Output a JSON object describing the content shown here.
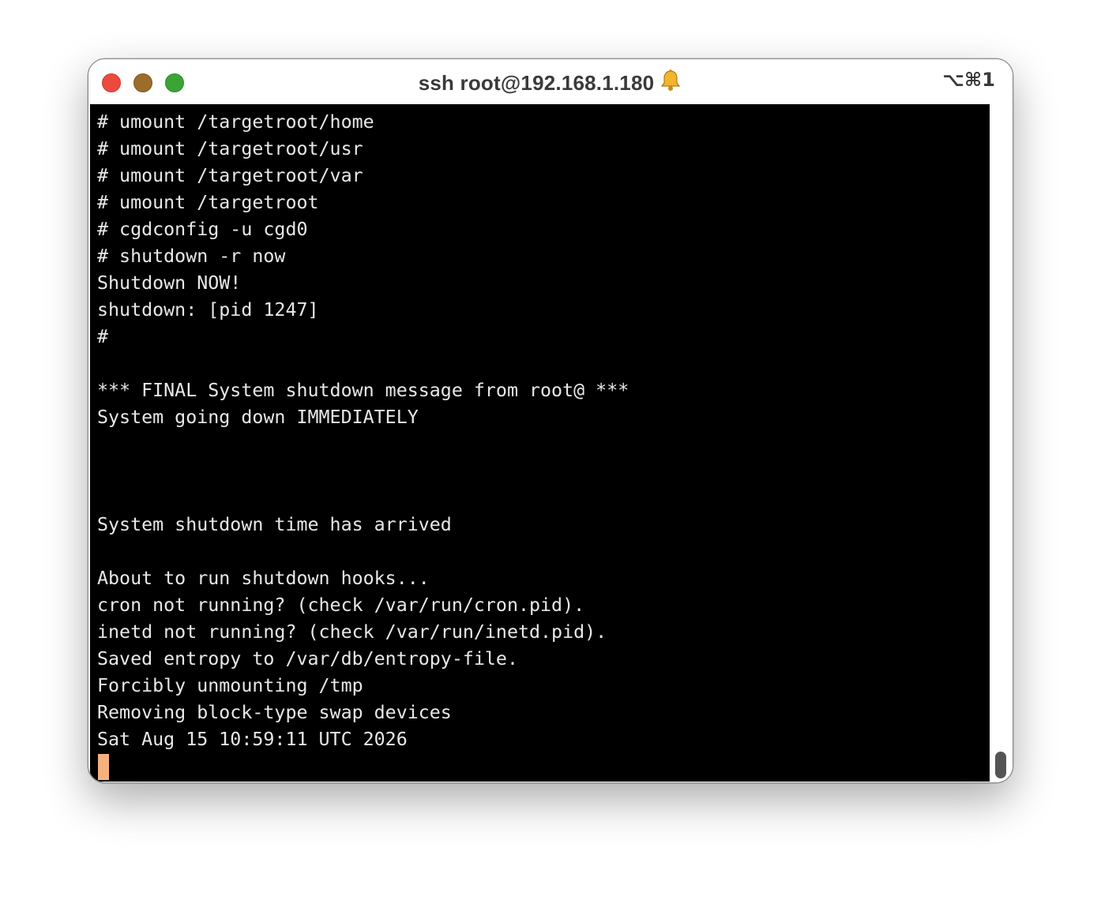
{
  "window": {
    "title": "ssh root@192.168.1.180",
    "shortcut": "⌥⌘1",
    "bell_icon": "bell-icon"
  },
  "terminal": {
    "lines": [
      "# umount /targetroot/home",
      "# umount /targetroot/usr",
      "# umount /targetroot/var",
      "# umount /targetroot",
      "# cgdconfig -u cgd0",
      "# shutdown -r now",
      "Shutdown NOW!",
      "shutdown: [pid 1247]",
      "#",
      "",
      "*** FINAL System shutdown message from root@ ***",
      "System going down IMMEDIATELY",
      "",
      "",
      "",
      "System shutdown time has arrived",
      "",
      "About to run shutdown hooks...",
      "cron not running? (check /var/run/cron.pid).",
      "inetd not running? (check /var/run/inetd.pid).",
      "Saved entropy to /var/db/entropy-file.",
      "Forcibly unmounting /tmp",
      "Removing block-type swap devices",
      "Sat Aug 15 10:59:11 UTC 2026"
    ]
  },
  "colors": {
    "close": "#ec4a3f",
    "minimize": "#9c6d2a",
    "maximize": "#3aa535",
    "terminal_bg": "#000000",
    "terminal_fg": "#e8e8e8",
    "cursor": "#f5b27e"
  }
}
